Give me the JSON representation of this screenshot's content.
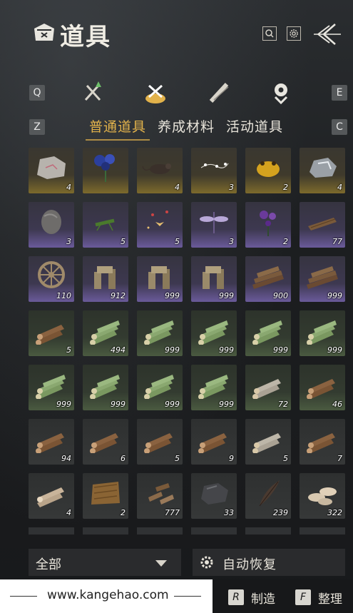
{
  "header": {
    "title": "道具",
    "search_icon": "search-icon",
    "settings_icon": "gear-icon",
    "back_icon": "back-arrow-icon"
  },
  "category_bar": {
    "left_key": "Q",
    "right_key": "E",
    "categories": [
      {
        "name": "weapons-category-icon"
      },
      {
        "name": "items-category-icon",
        "active": true
      },
      {
        "name": "scrolls-category-icon"
      },
      {
        "name": "location-category-icon"
      }
    ]
  },
  "sub_tabs": {
    "left_key": "Z",
    "right_key": "C",
    "tabs": [
      {
        "label": "普通道具",
        "active": true
      },
      {
        "label": "养成材料",
        "active": false
      },
      {
        "label": "活动道具",
        "active": false
      }
    ]
  },
  "items": [
    {
      "icon": "stone-icon",
      "qty": "4",
      "rarity": "gold"
    },
    {
      "icon": "blue-flower-icon",
      "qty": "",
      "rarity": "gold"
    },
    {
      "icon": "rat-icon",
      "qty": "4",
      "rarity": "gold"
    },
    {
      "icon": "firefly-icon",
      "qty": "3",
      "rarity": "gold"
    },
    {
      "icon": "golden-toad-icon",
      "qty": "2",
      "rarity": "gold"
    },
    {
      "icon": "ore-icon",
      "qty": "4",
      "rarity": "gold"
    },
    {
      "icon": "rock-icon",
      "qty": "3",
      "rarity": "purple"
    },
    {
      "icon": "grasshopper-icon",
      "qty": "5",
      "rarity": "purple"
    },
    {
      "icon": "butterfly-swarm-icon",
      "qty": "5",
      "rarity": "purple"
    },
    {
      "icon": "dragonfly-icon",
      "qty": "3",
      "rarity": "purple"
    },
    {
      "icon": "purple-flower-icon",
      "qty": "2",
      "rarity": "purple"
    },
    {
      "icon": "wood-plank-icon",
      "qty": "77",
      "rarity": "purple"
    },
    {
      "icon": "wheel-icon",
      "qty": "110",
      "rarity": "purple"
    },
    {
      "icon": "wooden-beams-icon",
      "qty": "912",
      "rarity": "purple"
    },
    {
      "icon": "wooden-beams-icon",
      "qty": "999",
      "rarity": "purple"
    },
    {
      "icon": "wooden-beams-icon",
      "qty": "999",
      "rarity": "purple"
    },
    {
      "icon": "log-pile-icon",
      "qty": "900",
      "rarity": "purple"
    },
    {
      "icon": "log-pile-icon",
      "qty": "999",
      "rarity": "purple"
    },
    {
      "icon": "logs-icon",
      "qty": "5",
      "rarity": "green"
    },
    {
      "icon": "bamboo-logs-icon",
      "qty": "494",
      "rarity": "green"
    },
    {
      "icon": "bamboo-logs-icon",
      "qty": "999",
      "rarity": "green"
    },
    {
      "icon": "bamboo-logs-icon",
      "qty": "999",
      "rarity": "green"
    },
    {
      "icon": "bamboo-logs-icon",
      "qty": "999",
      "rarity": "green"
    },
    {
      "icon": "bamboo-logs-icon",
      "qty": "999",
      "rarity": "green"
    },
    {
      "icon": "bamboo-logs-icon",
      "qty": "999",
      "rarity": "green"
    },
    {
      "icon": "bamboo-logs-icon",
      "qty": "999",
      "rarity": "green"
    },
    {
      "icon": "bamboo-logs-icon",
      "qty": "999",
      "rarity": "green"
    },
    {
      "icon": "bamboo-logs-icon",
      "qty": "999",
      "rarity": "green"
    },
    {
      "icon": "birch-logs-icon",
      "qty": "72",
      "rarity": "green"
    },
    {
      "icon": "logs-icon",
      "qty": "46",
      "rarity": "green"
    },
    {
      "icon": "logs-icon",
      "qty": "94",
      "rarity": "plain"
    },
    {
      "icon": "logs-icon",
      "qty": "6",
      "rarity": "plain"
    },
    {
      "icon": "logs-icon",
      "qty": "5",
      "rarity": "plain"
    },
    {
      "icon": "logs-icon",
      "qty": "9",
      "rarity": "plain"
    },
    {
      "icon": "birch-logs-icon",
      "qty": "5",
      "rarity": "plain"
    },
    {
      "icon": "logs-icon",
      "qty": "7",
      "rarity": "plain"
    },
    {
      "icon": "pale-logs-icon",
      "qty": "4",
      "rarity": "plain"
    },
    {
      "icon": "fur-pelt-icon",
      "qty": "2",
      "rarity": "plain"
    },
    {
      "icon": "wood-scraps-icon",
      "qty": "777",
      "rarity": "plain"
    },
    {
      "icon": "dark-stone-icon",
      "qty": "33",
      "rarity": "plain"
    },
    {
      "icon": "feather-icon",
      "qty": "239",
      "rarity": "plain"
    },
    {
      "icon": "mushroom-icon",
      "qty": "322",
      "rarity": "plain"
    }
  ],
  "bottom": {
    "filter_label": "全部",
    "auto_restore_label": "自动恢复"
  },
  "footer": {
    "site": "www.kangehao.com",
    "craft_key": "R",
    "craft_label": "制造",
    "sort_key": "F",
    "sort_label": "整理"
  },
  "colors": {
    "accent_gold": "#e2b24b",
    "rarity_gold": "#7d6a2c",
    "rarity_purple": "#6a5a9a",
    "rarity_green": "#4a5a40"
  }
}
